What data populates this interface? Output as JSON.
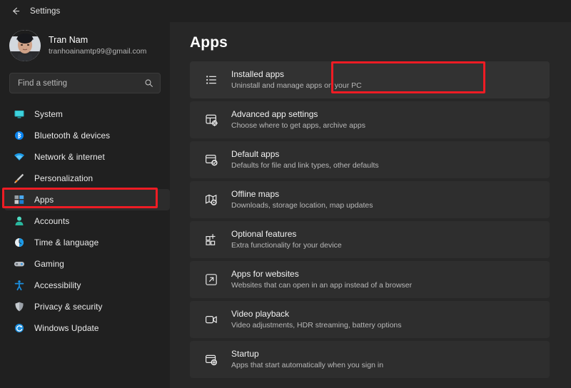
{
  "titlebar": {
    "back_icon": "back-arrow-icon",
    "label": "Settings"
  },
  "colors": {
    "page_bg": "#202020",
    "main_bg": "#272727",
    "card_bg": "#2e2e2e",
    "annotation": "#ee1c24",
    "accent_blue": "#0a84d8",
    "text_primary": "#f2f2f2",
    "text_secondary": "#b8b8b8"
  },
  "sidebar": {
    "profile": {
      "name": "Tran Nam",
      "email": "tranhoainamtp99@gmail.com",
      "avatar_icon": "user-avatar-photo"
    },
    "search": {
      "placeholder": "Find a setting",
      "value": "",
      "icon": "search-icon"
    },
    "items": [
      {
        "label": "System",
        "icon": "monitor-icon",
        "selected": false
      },
      {
        "label": "Bluetooth & devices",
        "icon": "bluetooth-icon",
        "selected": false
      },
      {
        "label": "Network & internet",
        "icon": "wifi-icon",
        "selected": false
      },
      {
        "label": "Personalization",
        "icon": "paintbrush-icon",
        "selected": false
      },
      {
        "label": "Apps",
        "icon": "apps-grid-icon",
        "selected": true
      },
      {
        "label": "Accounts",
        "icon": "person-icon",
        "selected": false
      },
      {
        "label": "Time & language",
        "icon": "clock-icon",
        "selected": false
      },
      {
        "label": "Gaming",
        "icon": "gamepad-icon",
        "selected": false
      },
      {
        "label": "Accessibility",
        "icon": "accessibility-icon",
        "selected": false
      },
      {
        "label": "Privacy & security",
        "icon": "shield-icon",
        "selected": false
      },
      {
        "label": "Windows Update",
        "icon": "update-refresh-icon",
        "selected": false
      }
    ]
  },
  "main": {
    "title": "Apps",
    "cards": [
      {
        "title": "Installed apps",
        "subtitle": "Uninstall and manage apps on your PC",
        "icon": "list-bullets-icon",
        "highlighted": true
      },
      {
        "title": "Advanced app settings",
        "subtitle": "Choose where to get apps, archive apps",
        "icon": "app-settings-icon",
        "highlighted": false
      },
      {
        "title": "Default apps",
        "subtitle": "Defaults for file and link types, other defaults",
        "icon": "window-check-icon",
        "highlighted": false
      },
      {
        "title": "Offline maps",
        "subtitle": "Downloads, storage location, map updates",
        "icon": "map-pin-icon",
        "highlighted": false
      },
      {
        "title": "Optional features",
        "subtitle": "Extra functionality for your device",
        "icon": "grid-plus-icon",
        "highlighted": false
      },
      {
        "title": "Apps for websites",
        "subtitle": "Websites that can open in an app instead of a browser",
        "icon": "external-link-icon",
        "highlighted": false
      },
      {
        "title": "Video playback",
        "subtitle": "Video adjustments, HDR streaming, battery options",
        "icon": "video-camera-icon",
        "highlighted": false
      },
      {
        "title": "Startup",
        "subtitle": "Apps that start automatically when you sign in",
        "icon": "startup-window-icon",
        "highlighted": false
      }
    ]
  },
  "annotations": [
    {
      "name": "annotation-box-apps-nav",
      "target": "Apps"
    },
    {
      "name": "annotation-box-installed-apps",
      "target": "Installed apps"
    }
  ]
}
